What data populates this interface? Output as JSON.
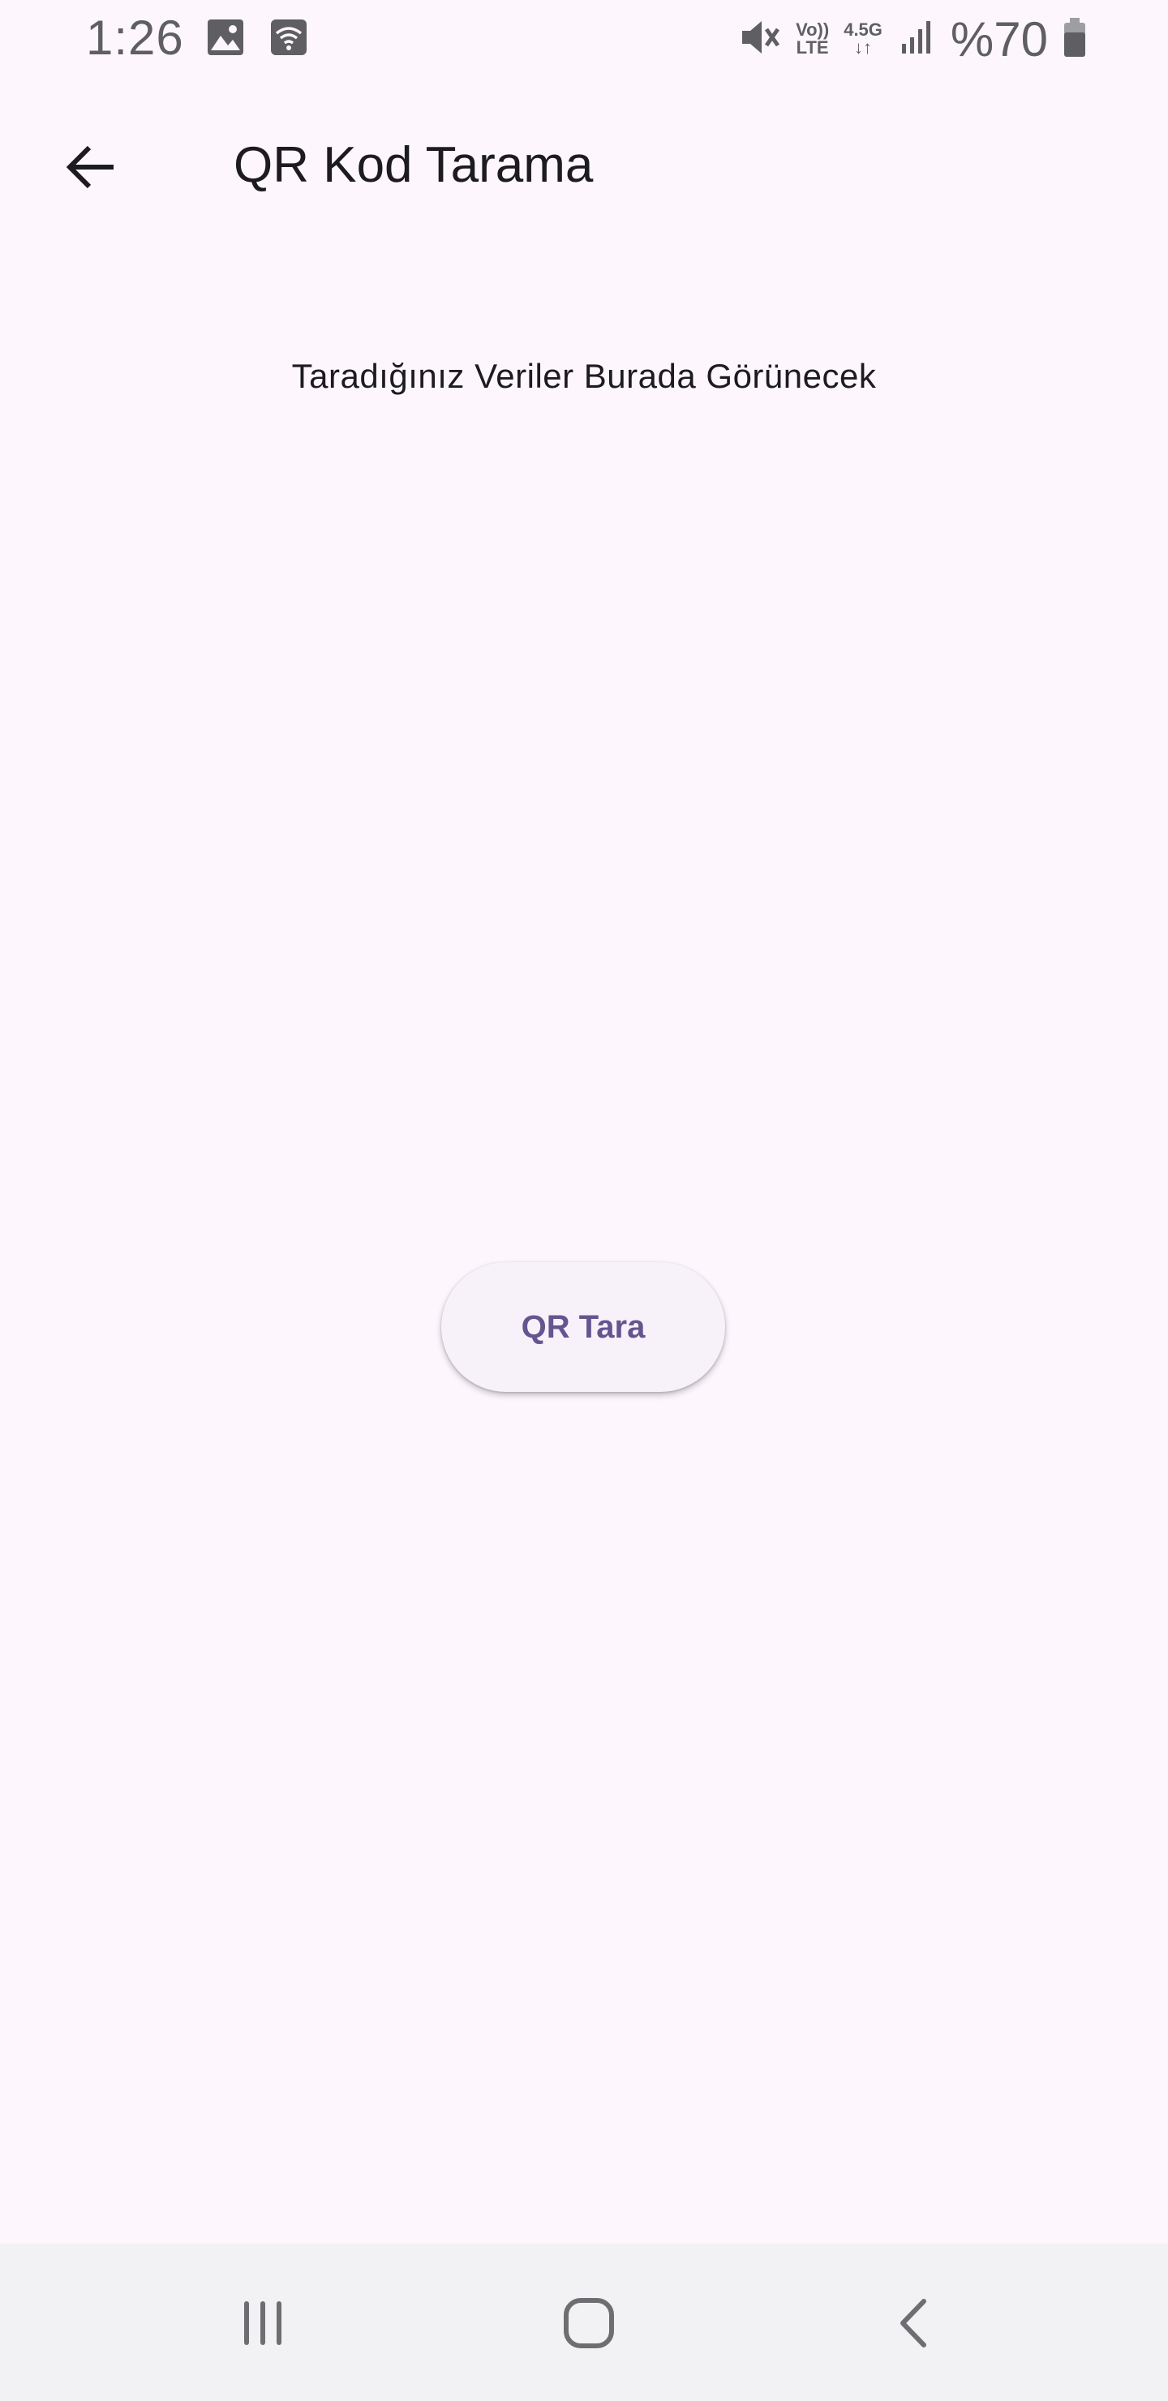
{
  "status_bar": {
    "time": "1:26",
    "battery": "%70",
    "volte_top": "Vo))",
    "volte_bottom": "LTE",
    "net_top": "4.5G",
    "net_bottom": "↓↑",
    "icons": [
      "image-icon",
      "wifi-icon",
      "mute-icon",
      "signal-icon",
      "battery-icon"
    ]
  },
  "app_bar": {
    "title": "QR Kod Tarama",
    "back_icon": "arrow-back-icon"
  },
  "content": {
    "scanned_data_text": "Taradığınız Veriler Burada Görünecek",
    "scan_button_label": "QR Tara"
  },
  "nav_bar": {
    "icons": [
      "recent-apps-icon",
      "home-icon",
      "back-icon"
    ]
  },
  "colors": {
    "background": "#FDF7FD",
    "text_primary": "#1D1B20",
    "button_text": "#65558F",
    "button_bg": "#F7F2FA",
    "nav_bg": "#F2F1F3",
    "status_icons": "#5F5F63"
  }
}
